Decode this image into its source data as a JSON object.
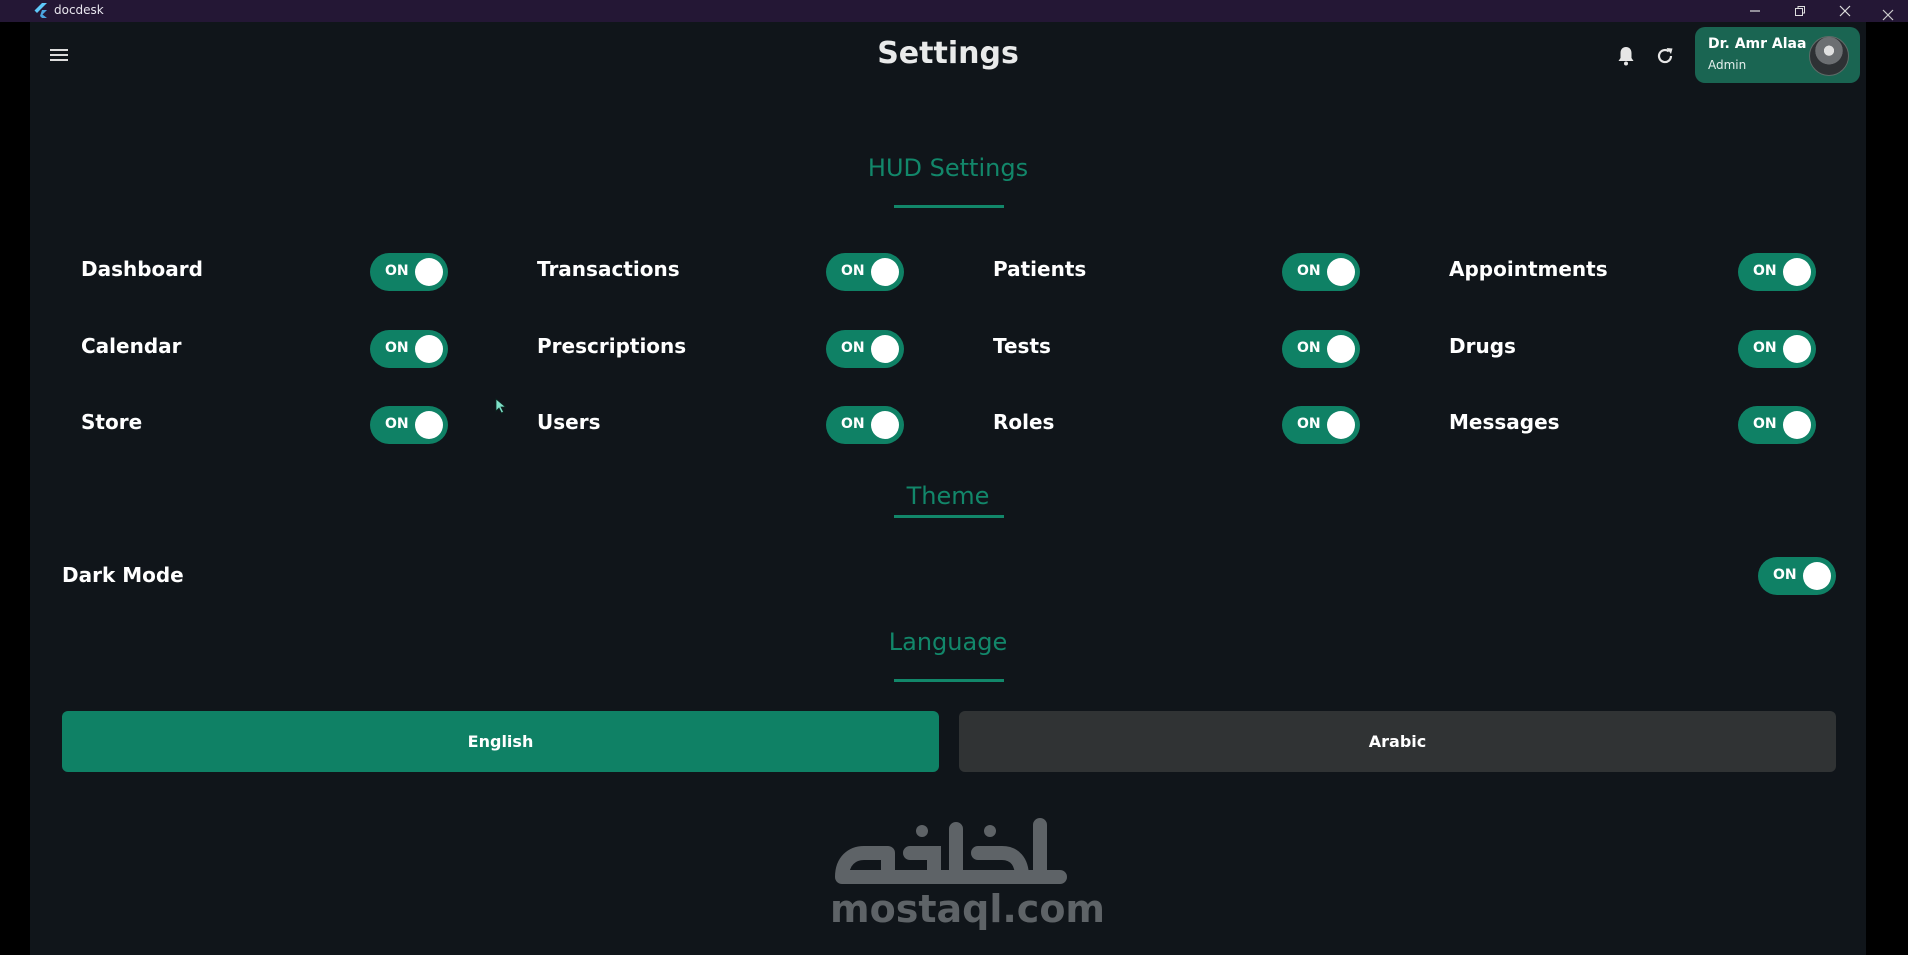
{
  "titlebar": {
    "app_name": "docdesk"
  },
  "header": {
    "title": "Settings",
    "icons": [
      "menu-icon",
      "bell-icon",
      "refresh-icon"
    ],
    "user": {
      "name": "Dr. Amr Alaa",
      "role": "Admin"
    }
  },
  "hud": {
    "title": "HUD Settings",
    "items": [
      {
        "label": "Dashboard",
        "state": "ON"
      },
      {
        "label": "Transactions",
        "state": "ON"
      },
      {
        "label": "Patients",
        "state": "ON"
      },
      {
        "label": "Appointments",
        "state": "ON"
      },
      {
        "label": "Calendar",
        "state": "ON"
      },
      {
        "label": "Prescriptions",
        "state": "ON"
      },
      {
        "label": "Tests",
        "state": "ON"
      },
      {
        "label": "Drugs",
        "state": "ON"
      },
      {
        "label": "Store",
        "state": "ON"
      },
      {
        "label": "Users",
        "state": "ON"
      },
      {
        "label": "Roles",
        "state": "ON"
      },
      {
        "label": "Messages",
        "state": "ON"
      }
    ]
  },
  "theme": {
    "title": "Theme",
    "dark_mode": {
      "label": "Dark Mode",
      "state": "ON"
    }
  },
  "language": {
    "title": "Language",
    "options": [
      "English",
      "Arabic"
    ],
    "selected": "English"
  },
  "watermark": {
    "text": "mostaql.com"
  },
  "colors": {
    "accent": "#0f8165",
    "background": "#10151a",
    "titlebar": "#241735"
  }
}
